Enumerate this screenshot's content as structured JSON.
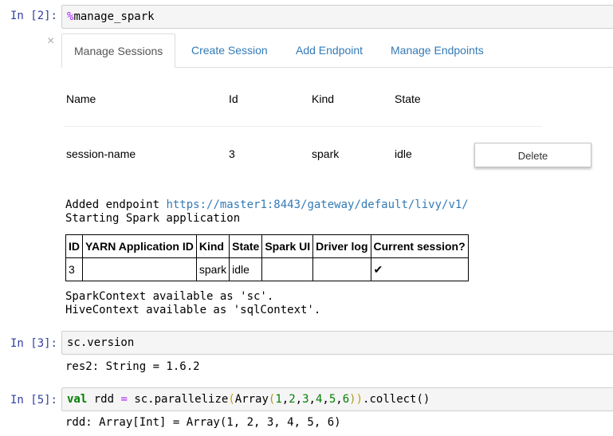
{
  "cells": [
    {
      "prompt": "In [2]:",
      "input_magic_prefix": "%",
      "input_rest": "manage_spark"
    },
    {
      "prompt": "In [3]:",
      "input": "sc.version",
      "output": "res2: String = 1.6.2"
    },
    {
      "prompt": "In [5]:",
      "output": "rdd: Array[Int] = Array(1, 2, 3, 4, 5, 6)"
    }
  ],
  "widget": {
    "close_glyph": "×",
    "tabs": [
      "Manage Sessions",
      "Create Session",
      "Add Endpoint",
      "Manage Endpoints"
    ],
    "active_tab": "Manage Sessions",
    "headers": {
      "name": "Name",
      "id": "Id",
      "kind": "Kind",
      "state": "State"
    },
    "session": {
      "name": "session-name",
      "id": "3",
      "kind": "spark",
      "state": "idle"
    },
    "delete_label": "Delete"
  },
  "output2": {
    "added_prefix": "Added endpoint ",
    "endpoint_url": "https://master1:8443/gateway/default/livy/v1/",
    "starting": "Starting Spark application",
    "table_headers": [
      "ID",
      "YARN Application ID",
      "Kind",
      "State",
      "Spark UI",
      "Driver log",
      "Current session?"
    ],
    "table_row": [
      "3",
      "",
      "spark",
      "idle",
      "",
      "",
      "✔"
    ],
    "spark_context": "SparkContext available as 'sc'.",
    "hive_context": "HiveContext available as 'sqlContext'."
  },
  "code5": {
    "kw": "val",
    "var": " rdd ",
    "eq": "=",
    "call": " sc.parallelize",
    "open1": "(",
    "array": "Array",
    "open2": "(",
    "n1": "1",
    "n2": "2",
    "n3": "3",
    "n4": "4",
    "n5": "5",
    "n6": "6",
    "comma": ",",
    "close2": ")",
    "close1": ")",
    "tail": ".collect()"
  }
}
